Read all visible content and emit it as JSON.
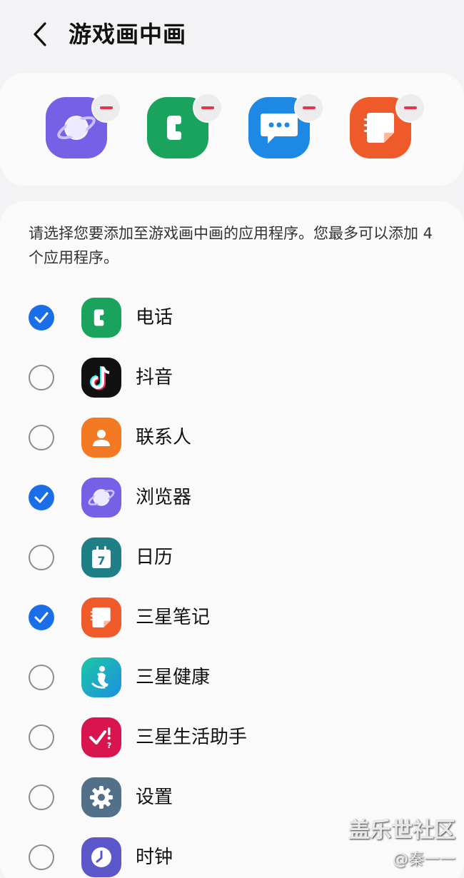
{
  "header": {
    "title": "游戏画中画"
  },
  "selected_apps": [
    {
      "name": "浏览器",
      "icon": "internet-browser-icon"
    },
    {
      "name": "电话",
      "icon": "phone-icon"
    },
    {
      "name": "信息",
      "icon": "messages-icon"
    },
    {
      "name": "三星笔记",
      "icon": "samsung-notes-icon"
    }
  ],
  "description": "请选择您要添加至游戏画中画的应用程序。您最多可以添加 4 个应用程序。",
  "apps": [
    {
      "label": "电话",
      "checked": true,
      "icon": "phone-icon"
    },
    {
      "label": "抖音",
      "checked": false,
      "icon": "douyin-icon"
    },
    {
      "label": "联系人",
      "checked": false,
      "icon": "contacts-icon"
    },
    {
      "label": "浏览器",
      "checked": true,
      "icon": "internet-browser-icon"
    },
    {
      "label": "日历",
      "checked": false,
      "icon": "calendar-icon"
    },
    {
      "label": "三星笔记",
      "checked": true,
      "icon": "samsung-notes-icon"
    },
    {
      "label": "三星健康",
      "checked": false,
      "icon": "samsung-health-icon"
    },
    {
      "label": "三星生活助手",
      "checked": false,
      "icon": "samsung-life-assistant-icon"
    },
    {
      "label": "设置",
      "checked": false,
      "icon": "settings-icon"
    },
    {
      "label": "时钟",
      "checked": false,
      "icon": "clock-icon"
    }
  ],
  "calendar_day": "7",
  "watermark": {
    "main": "盖乐世社区",
    "sub": "@秦一一"
  },
  "colors": {
    "accent": "#1a6fe8",
    "remove": "#e5364f",
    "phone": "#1aa35c",
    "browser": "#7660e6",
    "messages": "#1e88e5",
    "notes": "#ef5a2b",
    "contacts": "#f37a22",
    "calendar": "#1f7f86",
    "life_assistant": "#d8154e",
    "settings": "#53708a",
    "clock": "#5b57c9"
  }
}
